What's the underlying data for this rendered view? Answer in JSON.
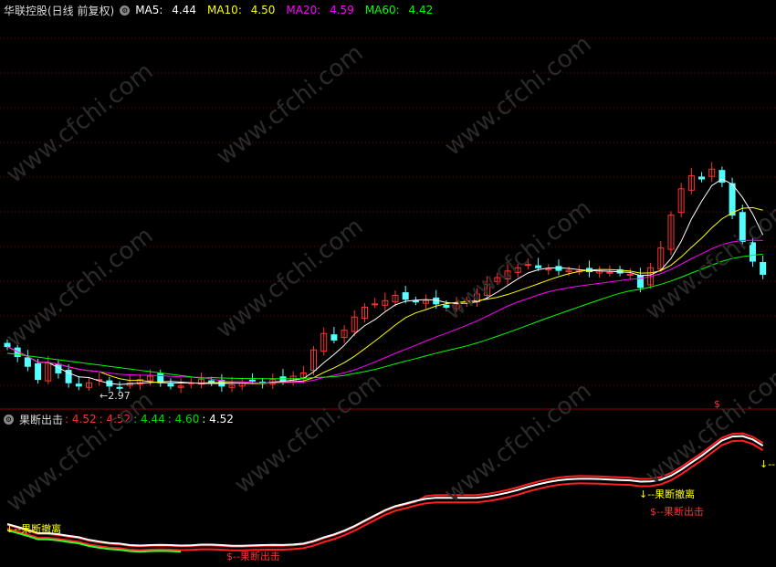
{
  "main_header": {
    "title": "华联控股(日线 前复权)",
    "ma": [
      {
        "label": "MA5:",
        "value": "4.44",
        "color": "#ffffff"
      },
      {
        "label": "MA10:",
        "value": "4.50",
        "color": "#ffff00"
      },
      {
        "label": "MA20:",
        "value": "4.59",
        "color": "#ff00ff"
      },
      {
        "label": "MA60:",
        "value": "4.42",
        "color": "#00ff00"
      }
    ]
  },
  "sub_header": {
    "title": "果断出击",
    "values": [
      {
        "text": ": 4.52",
        "color": "#ff3030"
      },
      {
        "text": ": 4.52",
        "color": "#ff3030"
      },
      {
        "text": ": 4.44",
        "color": "#00e000"
      },
      {
        "text": ": 4.60",
        "color": "#00e000"
      },
      {
        "text": ": 4.52",
        "color": "#ffffff"
      }
    ]
  },
  "annotations": {
    "low_price": "←2.97",
    "signal_s": "$",
    "label_exit1": "↓--果断撤离",
    "label_strike1": "$--果断出击",
    "label_exit2": "↓--果断撤离",
    "label_strike2": "$--果断出击",
    "label_exit3": "↓--"
  },
  "watermark": "www.cfchi.com",
  "colors": {
    "up": "#ff3232",
    "down": "#54ffff",
    "ma5": "#ffffff",
    "ma10": "#ffff00",
    "ma20": "#ff00ff",
    "ma60": "#00ff00",
    "grid": "#7a0000",
    "separator": "#8c0000"
  },
  "chart_data": {
    "type": "candlestick",
    "symbol": "华联控股",
    "period": "日线 前复权",
    "min_low": 2.97,
    "close_series": [
      3.6,
      3.45,
      3.3,
      3.1,
      3.35,
      3.2,
      3.05,
      3.0,
      3.05,
      3.1,
      3.0,
      2.97,
      3.05,
      3.1,
      3.15,
      3.05,
      3.0,
      3.0,
      3.05,
      3.1,
      3.05,
      3.0,
      3.02,
      3.05,
      3.08,
      3.05,
      3.1,
      3.08,
      3.15,
      3.2,
      3.55,
      3.8,
      3.7,
      3.85,
      4.05,
      4.2,
      4.25,
      4.3,
      4.38,
      4.32,
      4.28,
      4.3,
      4.25,
      4.2,
      4.25,
      4.3,
      4.4,
      4.55,
      4.65,
      4.75,
      4.8,
      4.85,
      4.8,
      4.78,
      4.76,
      4.76,
      4.75,
      4.74,
      4.75,
      4.73,
      4.72,
      4.7,
      4.5,
      4.8,
      5.1,
      5.6,
      6.0,
      6.2,
      6.15,
      6.3,
      6.1,
      5.6,
      5.2,
      4.9,
      4.7
    ]
  }
}
